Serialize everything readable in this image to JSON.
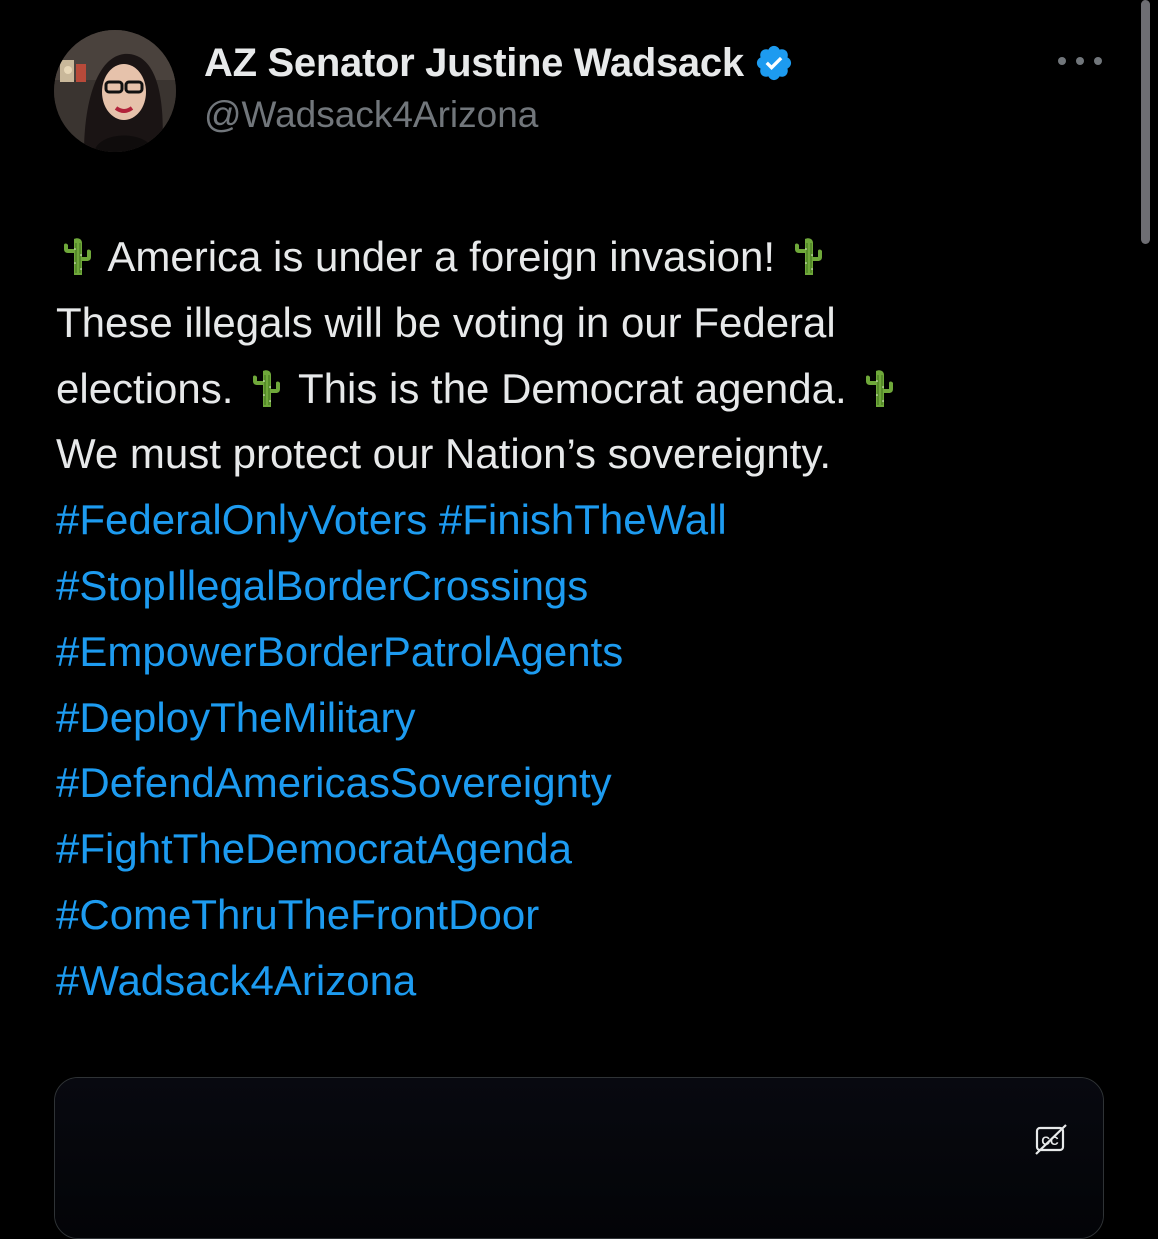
{
  "tweet": {
    "author": {
      "display_name": "AZ Senator Justine Wadsack",
      "handle": "@Wadsack4Arizona",
      "verified": true,
      "verified_color": "#1d9bf0"
    },
    "lines": [
      {
        "parts": [
          {
            "type": "emoji",
            "icon": "cactus-icon"
          },
          {
            "type": "text",
            "text": " America is under a foreign invasion! "
          },
          {
            "type": "emoji",
            "icon": "cactus-icon"
          }
        ]
      },
      {
        "parts": [
          {
            "type": "text",
            "text": "These illegals will be voting in our Federal"
          }
        ]
      },
      {
        "parts": [
          {
            "type": "text",
            "text": "elections. "
          },
          {
            "type": "emoji",
            "icon": "cactus-icon"
          },
          {
            "type": "text",
            "text": " This is the Democrat agenda. "
          },
          {
            "type": "emoji",
            "icon": "cactus-icon"
          }
        ]
      },
      {
        "parts": [
          {
            "type": "text",
            "text": "We must protect our Nation’s sovereignty."
          }
        ]
      },
      {
        "parts": [
          {
            "type": "hashtag",
            "text": "#FederalOnlyVoters"
          },
          {
            "type": "text",
            "text": " "
          },
          {
            "type": "hashtag",
            "text": "#FinishTheWall"
          }
        ]
      },
      {
        "parts": [
          {
            "type": "hashtag",
            "text": "#StopIllegalBorderCrossings"
          }
        ]
      },
      {
        "parts": [
          {
            "type": "hashtag",
            "text": "#EmpowerBorderPatrolAgents"
          }
        ]
      },
      {
        "parts": [
          {
            "type": "hashtag",
            "text": "#DeployTheMilitary"
          }
        ]
      },
      {
        "parts": [
          {
            "type": "hashtag",
            "text": "#DefendAmericasSovereignty"
          }
        ]
      },
      {
        "parts": [
          {
            "type": "hashtag",
            "text": "#FightTheDemocratAgenda"
          }
        ]
      },
      {
        "parts": [
          {
            "type": "hashtag",
            "text": "#ComeThruTheFrontDoor"
          }
        ]
      },
      {
        "parts": [
          {
            "type": "hashtag",
            "text": "#Wadsack4Arizona"
          }
        ]
      }
    ],
    "media": {
      "caption_icon": "closed-captions-off-icon"
    }
  },
  "colors": {
    "background": "#000000",
    "text": "#e7e9ea",
    "secondary_text": "#71767b",
    "hashtag": "#1d9bf0",
    "border": "#2f3336"
  },
  "icons": {
    "more": "more-options-icon",
    "verified": "verified-badge-icon"
  }
}
